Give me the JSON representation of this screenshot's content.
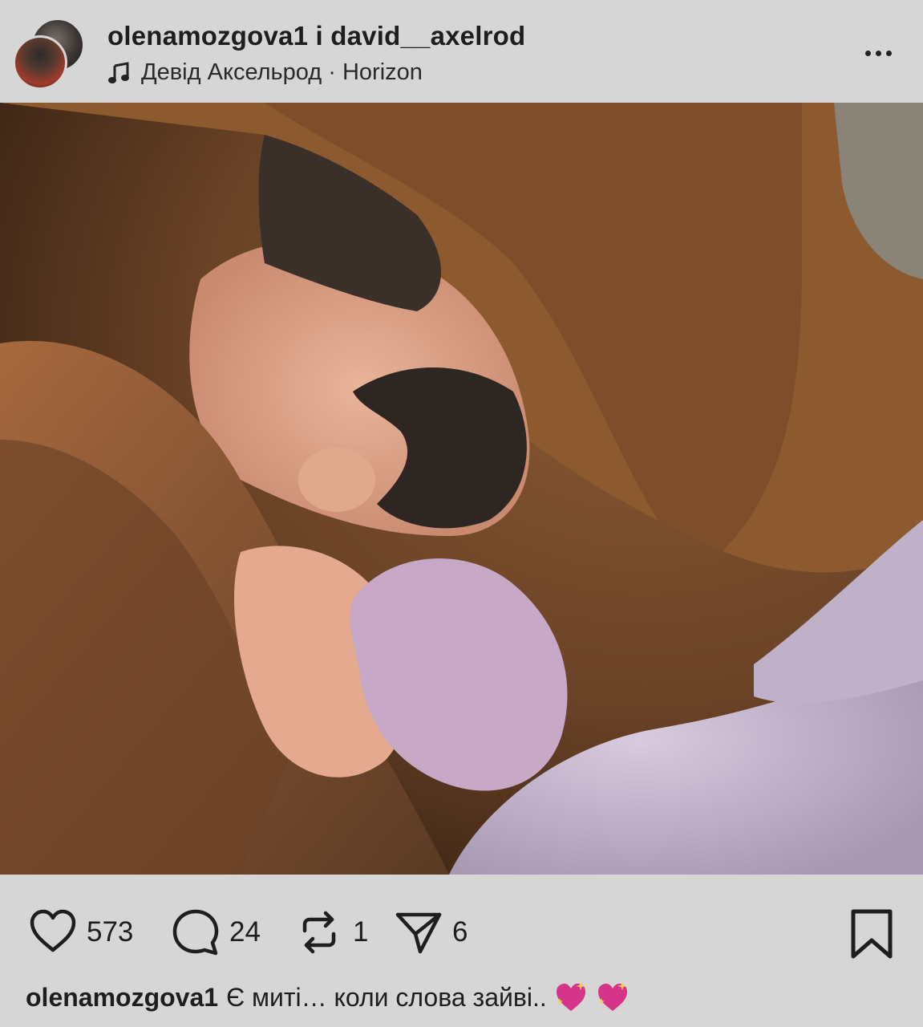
{
  "header": {
    "title": "olenamozgova1 і david__axelrod",
    "music_label": "Девід Аксельрод · Horizon",
    "more_icon": "more-horizontal-icon"
  },
  "photo": {
    "alt_icon": "post-photo"
  },
  "actions": {
    "likes": "573",
    "comments": "24",
    "reposts": "1",
    "shares": "6"
  },
  "caption": {
    "username": "olenamozgova1",
    "text": "Є миті… коли слова зайві..",
    "emoji": "sparkling-heart-icon"
  },
  "colors": {
    "background": "#d6d6d6",
    "text": "#1e1e1e",
    "heart_emoji": "#d6338a"
  }
}
